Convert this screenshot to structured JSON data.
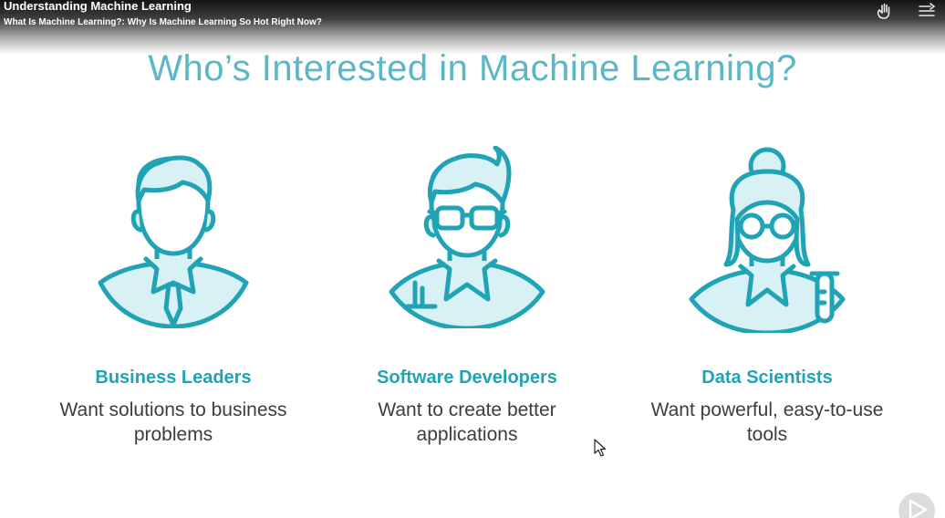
{
  "player": {
    "course_title": "Understanding Machine Learning",
    "clip_title": "What Is Machine Learning?: Why Is Machine Learning So Hot Right Now?",
    "icons": [
      "hand-raise-icon",
      "menu-arrow-icon",
      "play-icon"
    ]
  },
  "slide": {
    "title": "Who’s Interested in Machine Learning?",
    "accent_color": "#1fa3b5",
    "personas": [
      {
        "name": "Business Leaders",
        "description": "Want solutions to business problems",
        "icon": "business-leader-icon"
      },
      {
        "name": "Software Developers",
        "description": "Want to create better applications",
        "icon": "software-developer-icon"
      },
      {
        "name": "Data Scientists",
        "description": "Want powerful, easy-to-use tools",
        "icon": "data-scientist-icon"
      }
    ]
  }
}
